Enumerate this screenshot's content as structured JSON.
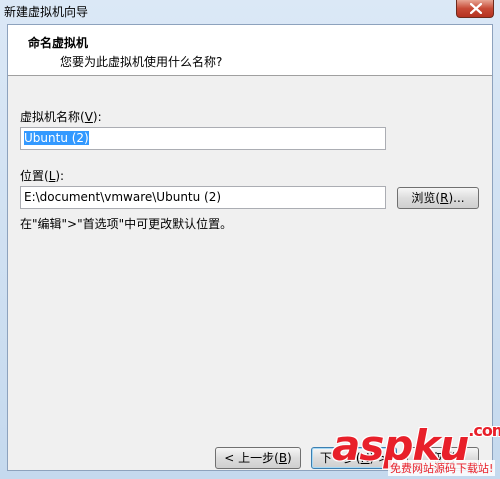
{
  "window": {
    "title": "新建虚拟机向导"
  },
  "header": {
    "title": "命名虚拟机",
    "subtitle": "您要为此虚拟机使用什么名称?"
  },
  "form": {
    "name_label": "虚拟机名称(",
    "name_label_key": "V",
    "name_label_end": "):",
    "name_value": "Ubuntu (2)",
    "location_label": "位置(",
    "location_label_key": "L",
    "location_label_end": "):",
    "location_value": "E:\\document\\vmware\\Ubuntu (2)",
    "browse_label": "浏览(",
    "browse_key": "R",
    "browse_end": ")...",
    "hint": "在\"编辑\">\"首选项\"中可更改默认位置。"
  },
  "footer": {
    "prev_label": "< 上一步(",
    "prev_key": "B",
    "prev_end": ")",
    "next_label": "下一步(",
    "next_key": "N",
    "next_end": ") >",
    "cancel_label": "取消"
  },
  "watermark": {
    "brand_a": "asp",
    "brand_b": "ku",
    "brand_c": ".com",
    "tagline": "免费网站源码下载站!"
  }
}
